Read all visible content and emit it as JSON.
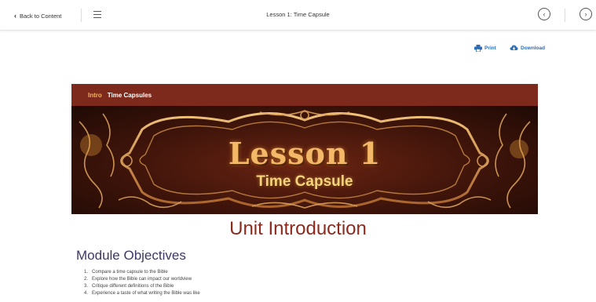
{
  "topbar": {
    "back_label": "Back to Content",
    "title": "Lesson 1: Time Capsule",
    "menu_icon": "hamburger-icon",
    "prev_icon": "chevron-left-circle-icon",
    "next_icon": "chevron-right-circle-icon"
  },
  "actions": {
    "print_label": "Print",
    "download_label": "Download",
    "link_color": "#2f6db5"
  },
  "section_bar": {
    "tag": "Intro",
    "name": "Time Capsules",
    "background": "#7d2a1c",
    "tag_color": "#f3b25c"
  },
  "banner": {
    "title": "Lesson 1",
    "subtitle": "Time Capsule"
  },
  "content": {
    "unit_heading": "Unit Introduction",
    "module_heading": "Module Objectives",
    "objectives": [
      {
        "num": "1.",
        "text": "Compare a time capsule to the Bible"
      },
      {
        "num": "2.",
        "text": "Explore how the Bible can impact our worldview"
      },
      {
        "num": "3.",
        "text": "Critique different definitions of the Bible"
      },
      {
        "num": "4.",
        "text": "Experience a taste of what writing the Bible was like"
      }
    ]
  }
}
